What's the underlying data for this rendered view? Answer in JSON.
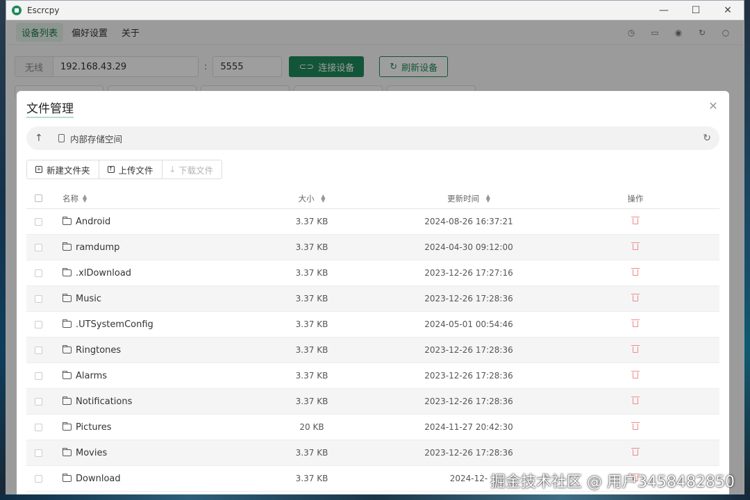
{
  "window": {
    "title": "Escrcpy",
    "controls": {
      "minimize": "—",
      "maximize": "☐",
      "close": "✕"
    }
  },
  "nav": {
    "items": [
      {
        "label": "设备列表",
        "active": true
      },
      {
        "label": "偏好设置",
        "active": false
      },
      {
        "label": "关于",
        "active": false
      }
    ],
    "icons": [
      "clock-icon",
      "screen-icon",
      "eye-icon",
      "refresh-icon",
      "search-icon"
    ]
  },
  "connection": {
    "mode_label": "无线",
    "ip_value": "192.168.43.29",
    "separator": ":",
    "port_value": "5555",
    "connect_label": "连接设备",
    "refresh_label": "刷新设备"
  },
  "modal": {
    "title": "文件管理",
    "close": "✕",
    "path": "内部存储空间",
    "toolbar": {
      "new_folder": "新建文件夹",
      "upload": "上传文件",
      "download": "下载文件"
    },
    "table": {
      "headers": {
        "name": "名称",
        "size": "大小",
        "time": "更新时间",
        "action": "操作"
      },
      "rows": [
        {
          "name": "Android",
          "size": "3.37 KB",
          "time": "2024-08-26 16:37:21"
        },
        {
          "name": "ramdump",
          "size": "3.37 KB",
          "time": "2024-04-30 09:12:00"
        },
        {
          "name": ".xlDownload",
          "size": "3.37 KB",
          "time": "2023-12-26 17:27:16"
        },
        {
          "name": "Music",
          "size": "3.37 KB",
          "time": "2023-12-26 17:28:36"
        },
        {
          "name": ".UTSystemConfig",
          "size": "3.37 KB",
          "time": "2024-05-01 00:54:46"
        },
        {
          "name": "Ringtones",
          "size": "3.37 KB",
          "time": "2023-12-26 17:28:36"
        },
        {
          "name": "Alarms",
          "size": "3.37 KB",
          "time": "2023-12-26 17:28:36"
        },
        {
          "name": "Notifications",
          "size": "3.37 KB",
          "time": "2023-12-26 17:28:36"
        },
        {
          "name": "Pictures",
          "size": "20 KB",
          "time": "2024-11-27 20:42:30"
        },
        {
          "name": "Movies",
          "size": "3.37 KB",
          "time": "2023-12-26 17:28:36"
        },
        {
          "name": "Download",
          "size": "3.37 KB",
          "time": "2024-12-"
        }
      ]
    }
  },
  "watermark": "掘金技术社区 @ 用户3458482850",
  "colors": {
    "accent": "#1f8a5b",
    "danger": "#f08a8a"
  }
}
